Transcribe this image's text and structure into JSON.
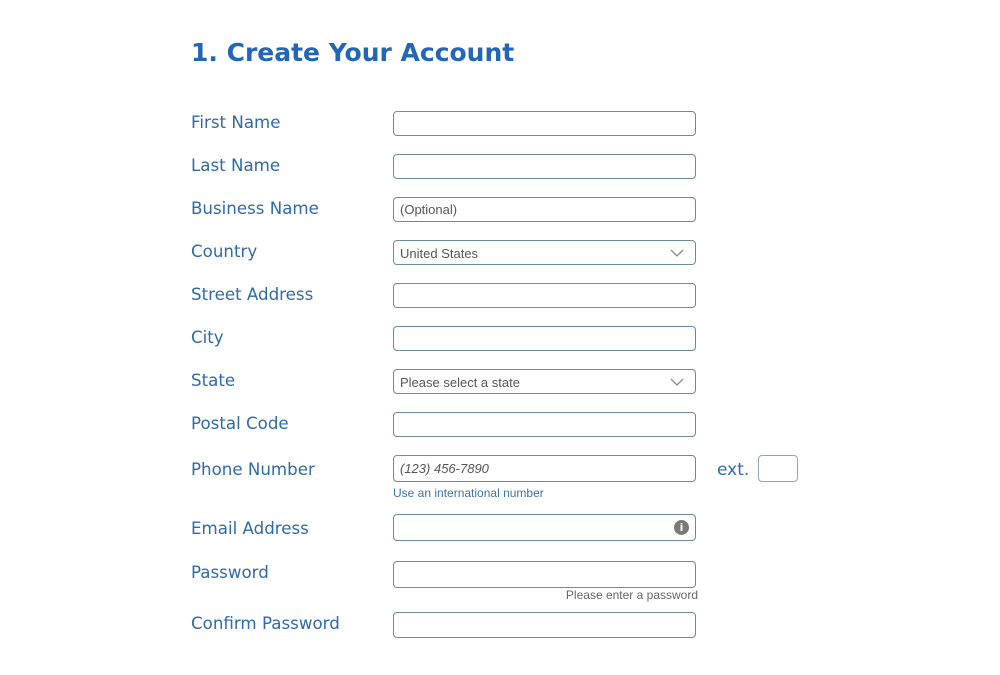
{
  "header": {
    "title": "1. Create Your Account"
  },
  "form": {
    "first_name": {
      "label": "First Name",
      "value": "",
      "placeholder": ""
    },
    "last_name": {
      "label": "Last Name",
      "value": "",
      "placeholder": ""
    },
    "business_name": {
      "label": "Business Name",
      "value": "",
      "placeholder": "(Optional)"
    },
    "country": {
      "label": "Country",
      "selected": "United States"
    },
    "street_address": {
      "label": "Street Address",
      "value": "",
      "placeholder": ""
    },
    "city": {
      "label": "City",
      "value": "",
      "placeholder": ""
    },
    "state": {
      "label": "State",
      "selected": "Please select a state"
    },
    "postal_code": {
      "label": "Postal Code",
      "value": "",
      "placeholder": ""
    },
    "phone_number": {
      "label": "Phone Number",
      "value": "",
      "placeholder": "(123) 456-7890",
      "ext_label": "ext.",
      "ext_value": "",
      "international_link": "Use an international number"
    },
    "email_address": {
      "label": "Email Address",
      "value": "",
      "placeholder": "",
      "icon": "info-icon",
      "icon_glyph": "i"
    },
    "password": {
      "label": "Password",
      "value": "",
      "placeholder": "",
      "hint": "Please enter a password"
    },
    "confirm_password": {
      "label": "Confirm Password",
      "value": "",
      "placeholder": ""
    }
  },
  "colors": {
    "heading": "#2366b8",
    "label": "#2f6aa8",
    "border": "#6a8aa0"
  }
}
